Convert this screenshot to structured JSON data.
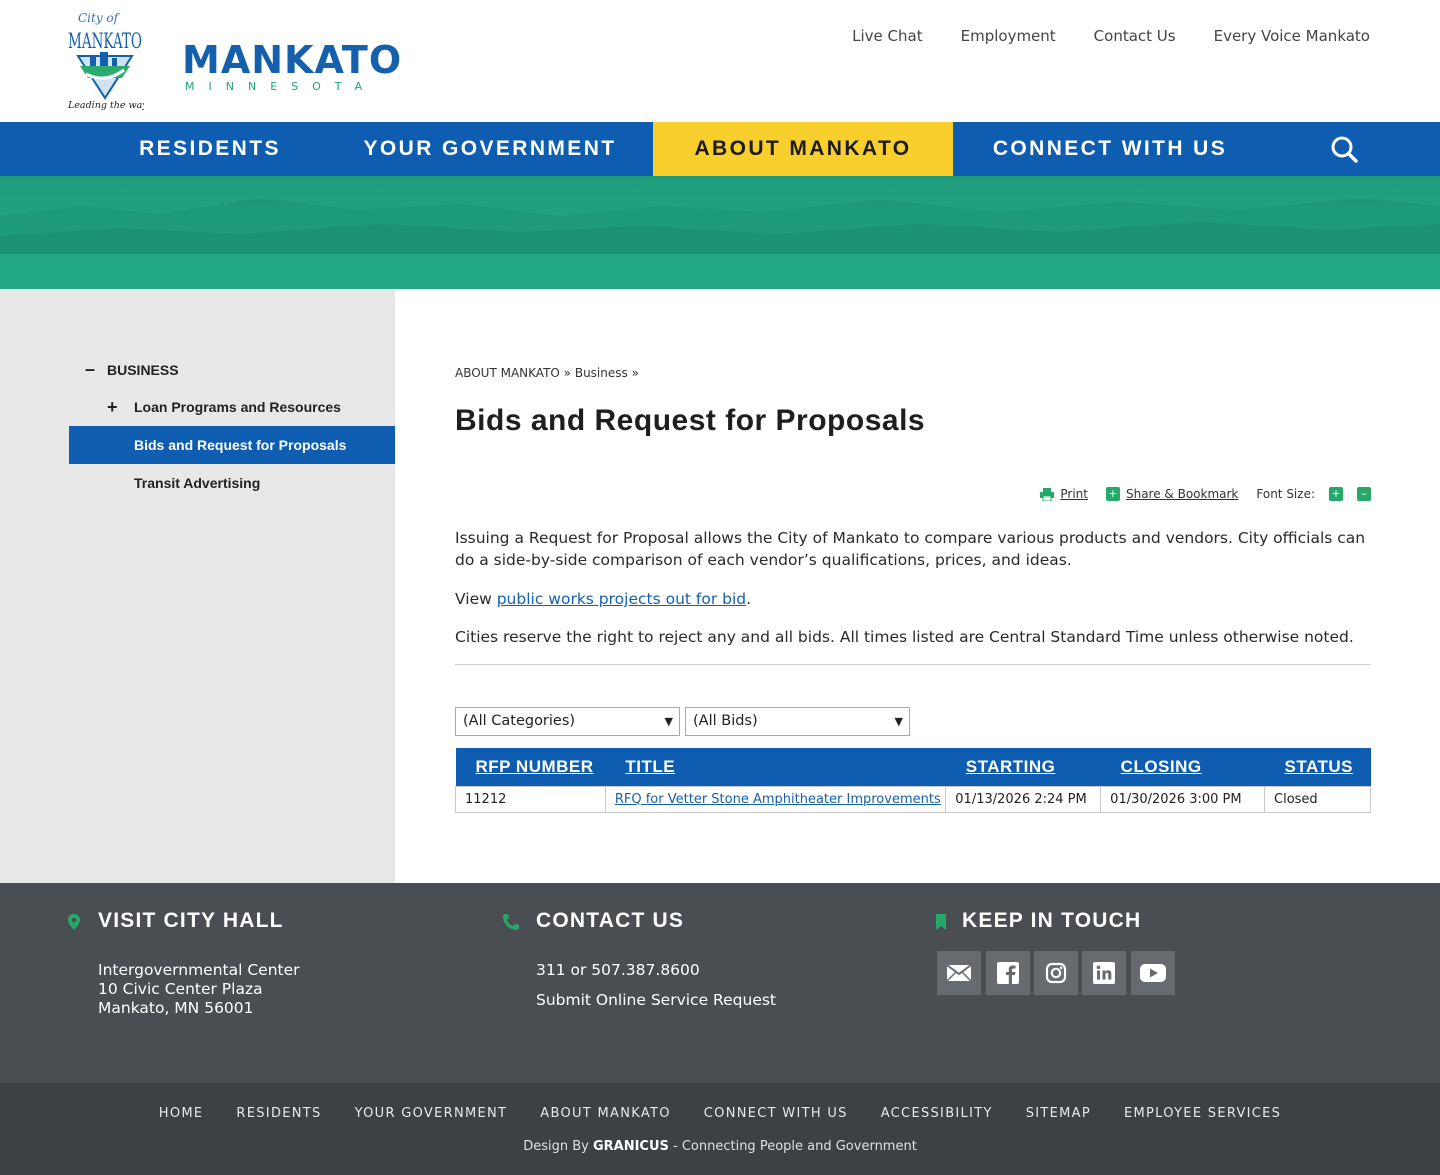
{
  "header": {
    "seal_text": "MANKATO",
    "seal_script_top": "City of",
    "seal_script_bottom": "Leading the way...",
    "wordmark": "MANKATO",
    "wordmark_sub": "MINNESOTA",
    "top_links": [
      "Live Chat",
      "Employment",
      "Contact Us",
      "Every Voice Mankato"
    ]
  },
  "nav": {
    "items": [
      "RESIDENTS",
      "YOUR GOVERNMENT",
      "ABOUT MANKATO",
      "CONNECT WITH US"
    ],
    "active": "ABOUT MANKATO"
  },
  "sidebar": {
    "section": "BUSINESS",
    "items": [
      "Loan Programs and Resources",
      "Bids and Request for Proposals",
      "Transit Advertising"
    ]
  },
  "main": {
    "breadcrumb": [
      "ABOUT MANKATO",
      "Business"
    ],
    "title": "Bids and Request for Proposals",
    "tools": {
      "print": "Print",
      "share": "Share & Bookmark",
      "font_size": "Font Size:"
    },
    "para1": "Issuing a Request for Proposal allows the City of Mankato to compare various products and vendors. City officials can do a side-by-side comparison of each vendor’s qualifications, prices, and ideas.",
    "para2_prefix": "View ",
    "para2_link": "public works projects out for bid",
    "para2_suffix": ".",
    "para3": "Cities reserve the right to reject any and all bids. All times listed are Central Standard Time unless otherwise noted.",
    "filter_category": "(All Categories)",
    "filter_bids": "(All Bids)",
    "table": {
      "headers": [
        "RFP NUMBER",
        "TITLE",
        "STARTING",
        "CLOSING",
        "STATUS"
      ],
      "rows": [
        [
          "11212",
          "RFQ for Vetter Stone Amphitheater Improvements",
          "01/13/2026 2:24 PM",
          "01/30/2026 3:00 PM",
          "Closed"
        ]
      ]
    }
  },
  "footer": {
    "visit_heading": "VISIT CITY HALL",
    "address": [
      "Intergovernmental Center",
      "10 Civic Center Plaza",
      "Mankato, MN 56001"
    ],
    "contact_heading": "CONTACT US",
    "phone": "311 or 507.387.8600",
    "service_request": "Submit Online Service Request",
    "keep_heading": "KEEP IN TOUCH",
    "bottom_links": [
      "HOME",
      "RESIDENTS",
      "YOUR GOVERNMENT",
      "ABOUT MANKATO",
      "CONNECT WITH US",
      "ACCESSIBILITY",
      "SITEMAP",
      "EMPLOYEE SERVICES"
    ],
    "credit_prefix": "Design By ",
    "credit_brand": "GRANICUS",
    "credit_suffix": " - Connecting People and Government"
  }
}
